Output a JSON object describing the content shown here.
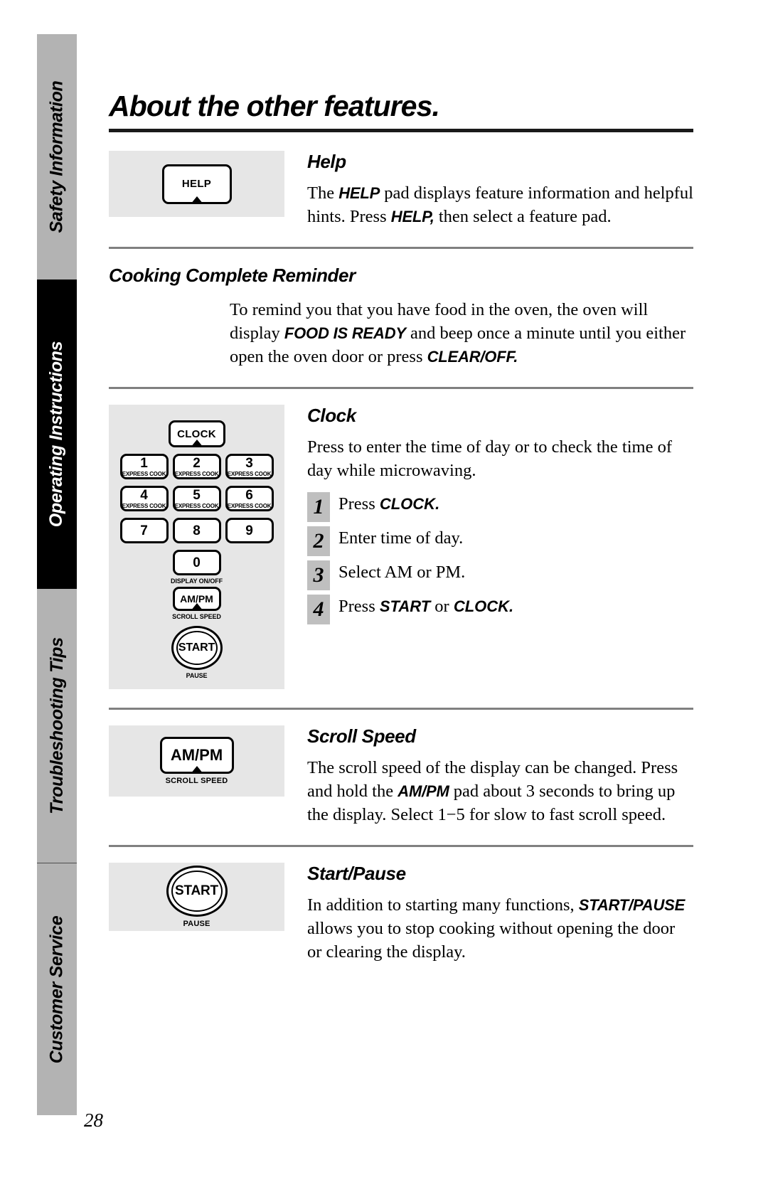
{
  "sidebar": {
    "tabs": [
      {
        "label": "Safety Information",
        "style": "gray"
      },
      {
        "label": "Operating Instructions",
        "style": "black"
      },
      {
        "label": "Troubleshooting Tips",
        "style": "gray"
      },
      {
        "label": "Customer Service",
        "style": "gray"
      }
    ]
  },
  "page": {
    "title": "About the other features.",
    "number": "28"
  },
  "help_section": {
    "heading": "Help",
    "pad_label": "HELP",
    "body_1": "The ",
    "body_bold_1": "HELP",
    "body_2": " pad displays feature information and helpful hints. Press ",
    "body_bold_2": "HELP,",
    "body_3": " then select a feature pad."
  },
  "reminder_section": {
    "heading": "Cooking Complete Reminder",
    "body_1": "To remind you that you have food in the oven, the oven will display ",
    "body_bold_1": "FOOD IS READY",
    "body_2": " and beep once a minute until you either open the oven door or press ",
    "body_bold_2": "CLEAR/OFF."
  },
  "clock_section": {
    "heading": "Clock",
    "intro": "Press to enter the time of day or to check the time of day while microwaving.",
    "steps": [
      {
        "num": "1",
        "text_1": "Press ",
        "bold_1": "CLOCK.",
        "text_2": ""
      },
      {
        "num": "2",
        "text_1": "Enter time of day.",
        "bold_1": "",
        "text_2": ""
      },
      {
        "num": "3",
        "text_1": "Select AM or PM.",
        "bold_1": "",
        "text_2": ""
      },
      {
        "num": "4",
        "text_1": "Press ",
        "bold_1": "START",
        "text_2": " or ",
        "bold_2": "CLOCK."
      }
    ],
    "keypad": {
      "clock_key": "CLOCK",
      "keys": [
        {
          "num": "1",
          "sub": "EXPRESS COOK"
        },
        {
          "num": "2",
          "sub": "EXPRESS COOK"
        },
        {
          "num": "3",
          "sub": "EXPRESS COOK"
        },
        {
          "num": "4",
          "sub": "EXPRESS COOK"
        },
        {
          "num": "5",
          "sub": "EXPRESS COOK"
        },
        {
          "num": "6",
          "sub": "EXPRESS COOK"
        },
        {
          "num": "7",
          "sub": ""
        },
        {
          "num": "8",
          "sub": ""
        },
        {
          "num": "9",
          "sub": ""
        }
      ],
      "zero_key": "0",
      "zero_caption": "DISPLAY ON/OFF",
      "ampm_key": "AM/PM",
      "ampm_caption": "SCROLL SPEED",
      "start_key": "START",
      "start_caption": "PAUSE"
    }
  },
  "scroll_section": {
    "heading": "Scroll Speed",
    "pad_label": "AM/PM",
    "pad_caption": "SCROLL SPEED",
    "body_1": "The scroll speed of the display can be changed. Press and hold the ",
    "body_bold_1": "AM/PM",
    "body_2": " pad about 3 seconds to bring up the display. Select 1−5 for slow to fast scroll speed."
  },
  "start_section": {
    "heading": "Start/Pause",
    "pad_label": "START",
    "pad_caption": "PAUSE",
    "body_1": "In addition to starting many functions, ",
    "body_bold_1": "START/PAUSE",
    "body_2": " allows you to stop cooking without opening the door or clearing the display."
  },
  "colors": {
    "tab_gray": "#b3b3b3",
    "tab_black": "#000000",
    "panel_gray": "#e6e6e6",
    "step_gray": "#bfbfbf",
    "rule_gray": "#808080"
  }
}
